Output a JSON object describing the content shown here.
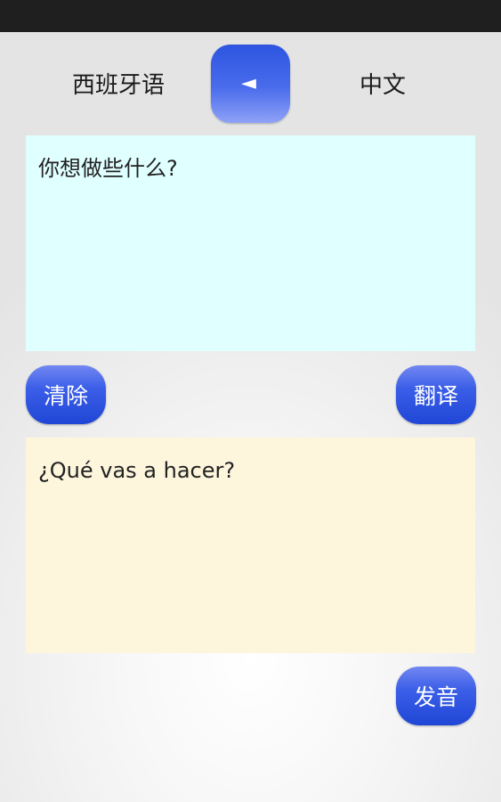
{
  "header": {
    "source_language": "西班牙语",
    "target_language": "中文",
    "swap_glyph": "◄"
  },
  "input": {
    "text": "你想做些什么?",
    "background_color": "#e0ffff"
  },
  "actions": {
    "clear_label": "清除",
    "translate_label": "翻译",
    "speak_label": "发音"
  },
  "output": {
    "text": "¿Qué vas a hacer?",
    "background_color": "#fdf5dc"
  },
  "colors": {
    "accent": "#2d55e0",
    "status_bar": "#1f1f1f"
  }
}
